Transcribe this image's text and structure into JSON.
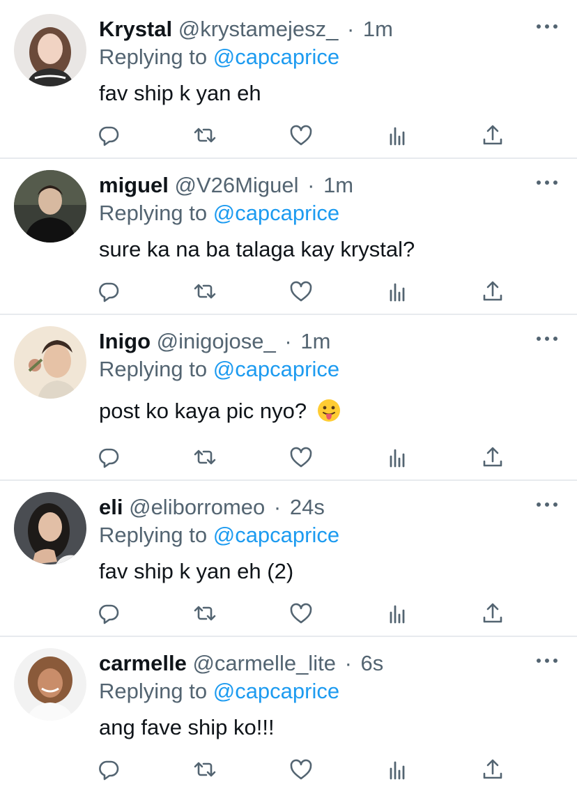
{
  "tweets": [
    {
      "name": "Krystal",
      "handle": "@krystamejesz_",
      "time": "1m",
      "replying_prefix": "Replying to",
      "replying_to": "@capcaprice",
      "text": "fav ship k yan eh"
    },
    {
      "name": "miguel",
      "handle": "@V26Miguel",
      "time": "1m",
      "replying_prefix": "Replying to",
      "replying_to": "@capcaprice",
      "text": "sure ka na ba talaga kay krystal?"
    },
    {
      "name": "Inigo",
      "handle": "@inigojose_",
      "time": "1m",
      "replying_prefix": "Replying to",
      "replying_to": "@capcaprice",
      "text": "post ko kaya pic nyo?",
      "emoji": "face-with-tongue-emoji"
    },
    {
      "name": "eli",
      "handle": "@eliborromeo",
      "time": "24s",
      "replying_prefix": "Replying to",
      "replying_to": "@capcaprice",
      "text": "fav ship k yan eh (2)"
    },
    {
      "name": "carmelle",
      "handle": "@carmelle_lite",
      "time": "6s",
      "replying_prefix": "Replying to",
      "replying_to": "@capcaprice",
      "text": "ang fave ship ko!!!"
    }
  ],
  "separator": "·",
  "icons": {
    "reply": "reply-icon",
    "retweet": "retweet-icon",
    "like": "heart-icon",
    "analytics": "analytics-icon",
    "share": "share-icon",
    "more": "more-icon"
  },
  "colors": {
    "text": "#0f1419",
    "secondary": "#536471",
    "link": "#1d9bf0",
    "divider": "#e7eaee"
  }
}
